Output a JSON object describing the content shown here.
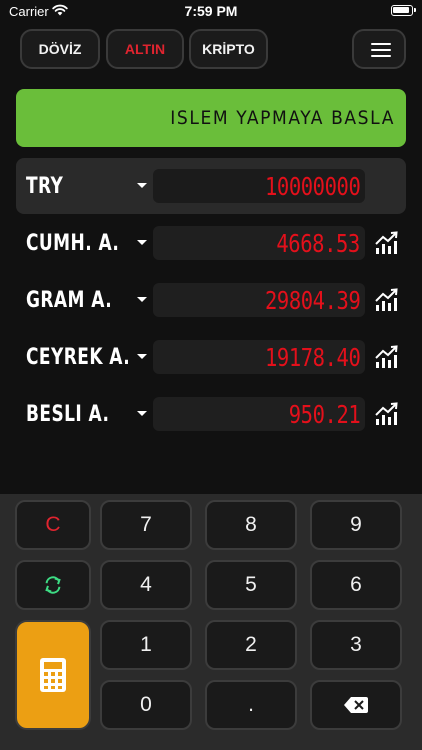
{
  "status_bar": {
    "carrier": "Carrier",
    "time": "7:59 PM"
  },
  "tabs": [
    {
      "label": "DÖVİZ",
      "active": false
    },
    {
      "label": "ALTIN",
      "active": true
    },
    {
      "label": "KRİPTO",
      "active": false
    }
  ],
  "banner": {
    "text": "ISLEM YAPMAYA BASLA"
  },
  "base": {
    "label": "TRY",
    "value": "10000000"
  },
  "rows": [
    {
      "label": "CUMH. A.",
      "value": "4668.53"
    },
    {
      "label": "GRAM A.",
      "value": "29804.39"
    },
    {
      "label": "CEYREK A.",
      "value": "19178.40"
    },
    {
      "label": "BESLI A.",
      "value": "950.21"
    }
  ],
  "keypad": {
    "clear": "C",
    "digits": [
      "7",
      "8",
      "9",
      "4",
      "5",
      "6",
      "1",
      "2",
      "3",
      "0"
    ],
    "decimal": "."
  },
  "colors": {
    "background": "#111111",
    "banner": "#6abe3a",
    "active_tab_text": "#e0242f",
    "value_text": "#e3101b",
    "calc_button": "#ec9f13",
    "swap_icon": "#3ddc84",
    "keypad_bg": "#2b2b2b"
  },
  "icons": [
    "wifi-icon",
    "battery-icon",
    "menu-icon",
    "dropdown-caret-icon",
    "chart-trend-icon",
    "swap-icon",
    "calculator-icon",
    "backspace-icon"
  ]
}
